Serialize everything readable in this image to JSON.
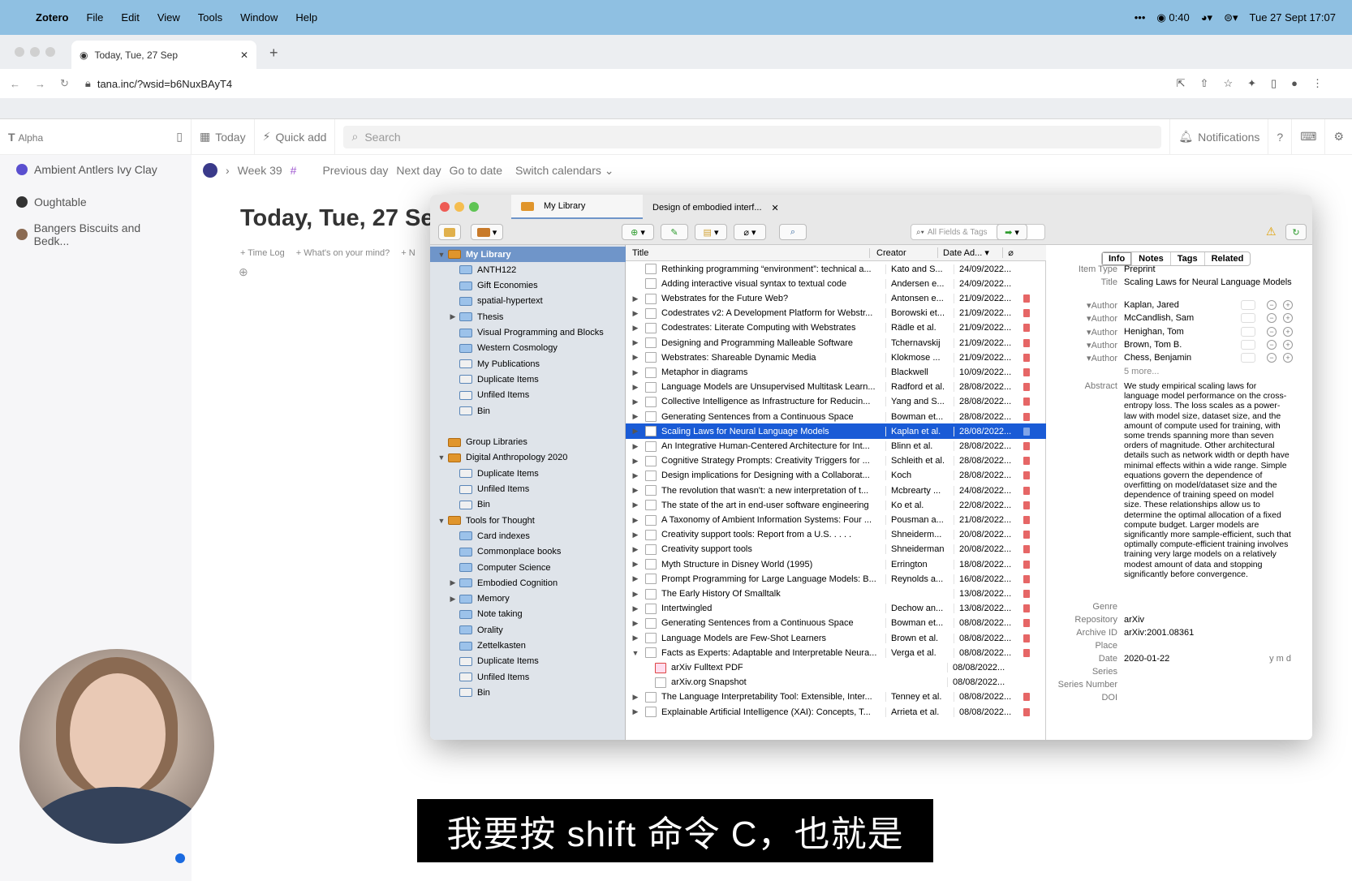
{
  "mac_menu": {
    "app": "Zotero",
    "items": [
      "File",
      "Edit",
      "View",
      "Tools",
      "Window",
      "Help"
    ],
    "status": {
      "timer": "0:40",
      "datetime": "Tue 27 Sept  17:07",
      "dots": "•••"
    }
  },
  "browser": {
    "tab_title": "Today, Tue, 27 Sep",
    "url": "tana.inc/?wsid=b6NuxBAyT4"
  },
  "tana": {
    "workspace": "Alpha",
    "today": "Today",
    "quick_add": "Quick add",
    "search_placeholder": "Search",
    "notifications": "Notifications",
    "sidebar": [
      {
        "label": "Ambient Antlers Ivy Clay",
        "color": "#5a4fcf"
      },
      {
        "label": "Oughtable",
        "color": "#333333"
      },
      {
        "label": "Bangers Biscuits and Bedk...",
        "color": "#8a6a52"
      }
    ],
    "breadcrumb": {
      "week": "Week 39",
      "hash": "#",
      "prev": "Previous day",
      "next": "Next day",
      "goto": "Go to date",
      "switch": "Switch calendars"
    },
    "title": "Today, Tue, 27 Se",
    "quick_actions": [
      "+ Time Log",
      "+ What's on your mind?",
      "+ N"
    ]
  },
  "zotero": {
    "tab1": "My Library",
    "tab2": "Design of embodied interf...",
    "search_placeholder": "All Fields & Tags",
    "columns": {
      "title": "Title",
      "creator": "Creator",
      "date": "Date Ad..."
    },
    "collections": [
      {
        "label": "My Library",
        "level": 0,
        "twisty": "▼",
        "selected": true
      },
      {
        "label": "ANTH122",
        "level": 2,
        "twisty": ""
      },
      {
        "label": "Gift Economies",
        "level": 2,
        "twisty": ""
      },
      {
        "label": "spatial-hypertext",
        "level": 2,
        "twisty": ""
      },
      {
        "label": "Thesis",
        "level": 2,
        "twisty": "▶"
      },
      {
        "label": "Visual Programming and Blocks",
        "level": 2,
        "twisty": ""
      },
      {
        "label": "Western Cosmology",
        "level": 2,
        "twisty": ""
      },
      {
        "label": "My Publications",
        "level": 2,
        "twisty": ""
      },
      {
        "label": "Duplicate Items",
        "level": 2,
        "twisty": ""
      },
      {
        "label": "Unfiled Items",
        "level": 2,
        "twisty": ""
      },
      {
        "label": "Bin",
        "level": 2,
        "twisty": ""
      },
      {
        "label": "",
        "level": 0,
        "twisty": ""
      },
      {
        "label": "Group Libraries",
        "level": 0,
        "twisty": ""
      },
      {
        "label": "Digital Anthropology 2020",
        "level": 1,
        "twisty": "▼"
      },
      {
        "label": "Duplicate Items",
        "level": 2,
        "twisty": ""
      },
      {
        "label": "Unfiled Items",
        "level": 2,
        "twisty": ""
      },
      {
        "label": "Bin",
        "level": 2,
        "twisty": ""
      },
      {
        "label": "Tools for Thought",
        "level": 1,
        "twisty": "▼"
      },
      {
        "label": "Card indexes",
        "level": 2,
        "twisty": ""
      },
      {
        "label": "Commonplace books",
        "level": 2,
        "twisty": ""
      },
      {
        "label": "Computer Science",
        "level": 2,
        "twisty": ""
      },
      {
        "label": "Embodied Cognition",
        "level": 2,
        "twisty": "▶"
      },
      {
        "label": "Memory",
        "level": 2,
        "twisty": "▶"
      },
      {
        "label": "Note taking",
        "level": 2,
        "twisty": ""
      },
      {
        "label": "Orality",
        "level": 2,
        "twisty": ""
      },
      {
        "label": "Zettelkasten",
        "level": 2,
        "twisty": ""
      },
      {
        "label": "Duplicate Items",
        "level": 2,
        "twisty": ""
      },
      {
        "label": "Unfiled Items",
        "level": 2,
        "twisty": ""
      },
      {
        "label": "Bin",
        "level": 2,
        "twisty": ""
      }
    ],
    "items": [
      {
        "t": "Rethinking programming “environment”: technical a...",
        "c": "Kato and S...",
        "d": "24/09/2022...",
        "a": "",
        "pdf": false
      },
      {
        "t": "Adding interactive visual syntax to textual code",
        "c": "Andersen e...",
        "d": "24/09/2022...",
        "a": "",
        "pdf": false
      },
      {
        "t": "Webstrates for the Future Web?",
        "c": "Antonsen e...",
        "d": "21/09/2022...",
        "a": "▶",
        "pdf": true
      },
      {
        "t": "Codestrates v2: A Development Platform for Webstr...",
        "c": "Borowski et...",
        "d": "21/09/2022...",
        "a": "▶",
        "pdf": true
      },
      {
        "t": "Codestrates: Literate Computing with Webstrates",
        "c": "Rädle et al.",
        "d": "21/09/2022...",
        "a": "▶",
        "pdf": true
      },
      {
        "t": "Designing and Programming Malleable Software",
        "c": "Tchernavskij",
        "d": "21/09/2022...",
        "a": "▶",
        "pdf": true
      },
      {
        "t": "Webstrates: Shareable Dynamic Media",
        "c": "Klokmose ...",
        "d": "21/09/2022...",
        "a": "▶",
        "pdf": true
      },
      {
        "t": "Metaphor in diagrams",
        "c": "Blackwell",
        "d": "10/09/2022...",
        "a": "▶",
        "pdf": true
      },
      {
        "t": "Language Models are Unsupervised Multitask Learn...",
        "c": "Radford et al.",
        "d": "28/08/2022...",
        "a": "▶",
        "pdf": true
      },
      {
        "t": "Collective Intelligence as Infrastructure for Reducin...",
        "c": "Yang and S...",
        "d": "28/08/2022...",
        "a": "▶",
        "pdf": true
      },
      {
        "t": "Generating Sentences from a Continuous Space",
        "c": "Bowman et...",
        "d": "28/08/2022...",
        "a": "▶",
        "pdf": true
      },
      {
        "t": "Scaling Laws for Neural Language Models",
        "c": "Kaplan et al.",
        "d": "28/08/2022...",
        "a": "▶",
        "pdf": true,
        "sel": true
      },
      {
        "t": "An Integrative Human-Centered Architecture for Int...",
        "c": "Blinn et al.",
        "d": "28/08/2022...",
        "a": "▶",
        "pdf": true
      },
      {
        "t": "Cognitive Strategy Prompts: Creativity Triggers for ...",
        "c": "Schleith et al.",
        "d": "28/08/2022...",
        "a": "▶",
        "pdf": true
      },
      {
        "t": "Design implications for Designing with a Collaborat...",
        "c": "Koch",
        "d": "28/08/2022...",
        "a": "▶",
        "pdf": true
      },
      {
        "t": "The revolution that wasn't: a new interpretation of t...",
        "c": "Mcbrearty ...",
        "d": "24/08/2022...",
        "a": "▶",
        "pdf": true
      },
      {
        "t": "The state of the art in end-user software engineering",
        "c": "Ko et al.",
        "d": "22/08/2022...",
        "a": "▶",
        "pdf": true
      },
      {
        "t": "A Taxonomy of Ambient Information Systems: Four ...",
        "c": "Pousman a...",
        "d": "21/08/2022...",
        "a": "▶",
        "pdf": true
      },
      {
        "t": "Creativity support tools: Report from a U.S. . . . .",
        "c": "Shneiderm...",
        "d": "20/08/2022...",
        "a": "▶",
        "pdf": true
      },
      {
        "t": "Creativity support tools",
        "c": "Shneiderman",
        "d": "20/08/2022...",
        "a": "▶",
        "pdf": true
      },
      {
        "t": "Myth Structure in Disney World (1995)",
        "c": "Errington",
        "d": "18/08/2022...",
        "a": "▶",
        "pdf": true
      },
      {
        "t": "Prompt Programming for Large Language Models: B...",
        "c": "Reynolds a...",
        "d": "16/08/2022...",
        "a": "▶",
        "pdf": true
      },
      {
        "t": "The Early History Of Smalltalk",
        "c": "",
        "d": "13/08/2022...",
        "a": "▶",
        "pdf": true
      },
      {
        "t": "Intertwingled",
        "c": "Dechow an...",
        "d": "13/08/2022...",
        "a": "▶",
        "pdf": true
      },
      {
        "t": "Generating Sentences from a Continuous Space",
        "c": "Bowman et...",
        "d": "08/08/2022...",
        "a": "▶",
        "pdf": true
      },
      {
        "t": "Language Models are Few-Shot Learners",
        "c": "Brown et al.",
        "d": "08/08/2022...",
        "a": "▶",
        "pdf": true
      },
      {
        "t": "Facts as Experts: Adaptable and Interpretable Neura...",
        "c": "Verga et al.",
        "d": "08/08/2022...",
        "a": "▼",
        "pdf": true
      },
      {
        "t": "arXiv Fulltext PDF",
        "c": "",
        "d": "08/08/2022...",
        "a": "",
        "pdf": false,
        "child": true
      },
      {
        "t": "arXiv.org Snapshot",
        "c": "",
        "d": "08/08/2022...",
        "a": "",
        "pdf": false,
        "child": true
      },
      {
        "t": "The Language Interpretability Tool: Extensible, Inter...",
        "c": "Tenney et al.",
        "d": "08/08/2022...",
        "a": "▶",
        "pdf": true
      },
      {
        "t": "Explainable Artificial Intelligence (XAI): Concepts, T...",
        "c": "Arrieta et al.",
        "d": "08/08/2022...",
        "a": "▶",
        "pdf": true
      }
    ],
    "info_tabs": [
      "Info",
      "Notes",
      "Tags",
      "Related"
    ],
    "info": {
      "item_type_label": "Item Type",
      "item_type": "Preprint",
      "title_label": "Title",
      "title": "Scaling Laws for Neural Language Models",
      "author_label": "Author",
      "authors": [
        "Kaplan, Jared",
        "McCandlish, Sam",
        "Henighan, Tom",
        "Brown, Tom B.",
        "Chess, Benjamin"
      ],
      "more": "5 more...",
      "abstract_label": "Abstract",
      "abstract": "We study empirical scaling laws for language model performance on the cross-entropy loss. The loss scales as a power-law with model size, dataset size, and the amount of compute used for training, with some trends spanning more than seven orders of magnitude. Other architectural details such as network width or depth have minimal effects within a wide range. Simple equations govern the dependence of overfitting on model/dataset size and the dependence of training speed on model size. These relationships allow us to determine the optimal allocation of a fixed compute budget. Larger models are significantly more sample-efficient, such that optimally compute-efficient training involves training very large models on a relatively modest amount of data and stopping significantly before convergence.",
      "genre_label": "Genre",
      "repository_label": "Repository",
      "repository": "arXiv",
      "archive_id_label": "Archive ID",
      "archive_id": "arXiv:2001.08361",
      "place_label": "Place",
      "date_label": "Date",
      "date": "2020-01-22",
      "ymd": "y m d",
      "series_label": "Series",
      "series_number_label": "Series Number",
      "doi_label": "DOI"
    }
  },
  "subtitle": "我要按 shift 命令 C，也就是"
}
